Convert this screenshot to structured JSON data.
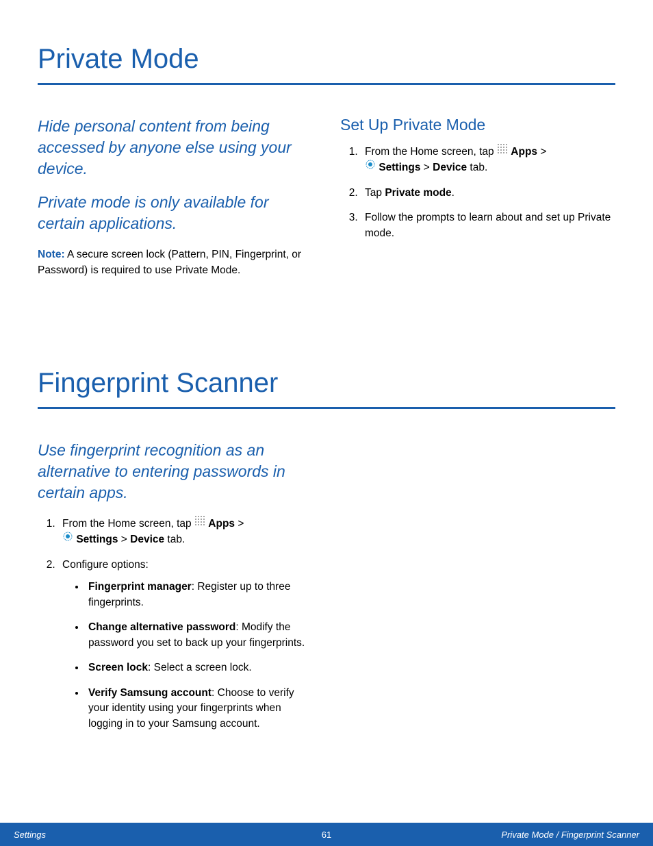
{
  "section1": {
    "title": "Private Mode",
    "intro1": "Hide personal content from being accessed by anyone else using your device.",
    "intro2": "Private mode is only available for certain applications.",
    "note_label": "Note:",
    "note_text": " A secure screen lock (Pattern, PIN, Fingerprint, or Password) is required to use Private Mode.",
    "subheading": "Set Up Private Mode",
    "steps": {
      "s1_pre": "From the Home screen, tap ",
      "s1_apps": "Apps",
      "s1_gt1": " > ",
      "s1_settings": "Settings",
      "s1_gt2": " > ",
      "s1_device": "Device",
      "s1_tab": " tab.",
      "s2_pre": "Tap ",
      "s2_bold": "Private mode",
      "s2_post": ".",
      "s3": "Follow the prompts to learn about and set up Private mode."
    }
  },
  "section2": {
    "title": "Fingerprint Scanner",
    "intro": "Use fingerprint recognition as an alternative to entering passwords in certain apps.",
    "steps": {
      "s1_pre": "From the Home screen, tap ",
      "s1_apps": "Apps",
      "s1_gt1": " > ",
      "s1_settings": "Settings",
      "s1_gt2": " > ",
      "s1_device": "Device",
      "s1_tab": " tab.",
      "s2": "Configure options:"
    },
    "bullets": {
      "b1_bold": "Fingerprint manager",
      "b1_text": ": Register up to three fingerprints.",
      "b2_bold": "Change alternative password",
      "b2_text": ": Modify the password you set to back up your fingerprints.",
      "b3_bold": "Screen lock",
      "b3_text": ": Select a screen lock.",
      "b4_bold": "Verify Samsung account",
      "b4_text": ": Choose to verify your identity using your fingerprints when logging in to your Samsung account."
    }
  },
  "footer": {
    "left": "Settings",
    "center": "61",
    "right": "Private Mode / Fingerprint Scanner"
  }
}
